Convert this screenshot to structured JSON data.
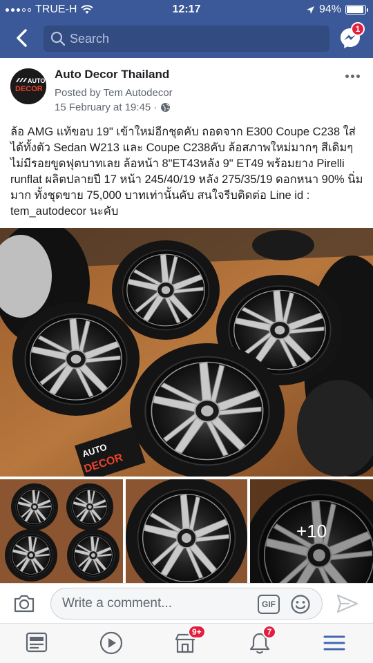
{
  "status_bar": {
    "carrier": "TRUE-H",
    "time": "12:17",
    "battery": "94%",
    "battery_level": 0.94
  },
  "header": {
    "search_placeholder": "Search",
    "messenger_badge": "1",
    "back_icon": "chevron-left-icon",
    "messenger_icon": "messenger-icon",
    "bg_color": "#3b5998"
  },
  "post": {
    "author": "Auto Decor Thailand",
    "posted_by": "Posted by Tem Autodecor",
    "time": "15 February at 19:45 ·",
    "privacy_icon": "globe-icon",
    "avatar_logo": "AUTO DECOR",
    "text": "ล้อ AMG แท้ขอบ 19\" เข้าใหม่อีกชุดคับ ถอดจาก E300 Coupe C238 ใส่ได้ทั้งตัว Sedan W213 และ Coupe C238คับ ล้อสภาพใหม่มากๆ สีเดิมๆ ไม่มีรอยขูดฟุตบาทเลย ล้อหน้า 8\"ET43หลัง 9\" ET49 พร้อมยาง Pirelli runflat ผลิตปลายปี 17 หน้า 245/40/19 หลัง 275/35/19 ดอกหนา 90% นิ่มมาก ทั้งชุดขาย 75,000 บาทเท่านั้นคับ สนใจรีบติดต่อ Line id : tem_autodecor นะคับ",
    "photo_logo": "AUTO DECOR",
    "more_photos": "+10"
  },
  "comment": {
    "placeholder": "Write a comment...",
    "gif_label": "GIF"
  },
  "tabbar": {
    "items": [
      {
        "name": "news-feed-icon"
      },
      {
        "name": "watch-icon"
      },
      {
        "name": "marketplace-icon",
        "badge": "9+"
      },
      {
        "name": "notifications-icon",
        "badge": "7"
      },
      {
        "name": "menu-icon"
      }
    ]
  }
}
